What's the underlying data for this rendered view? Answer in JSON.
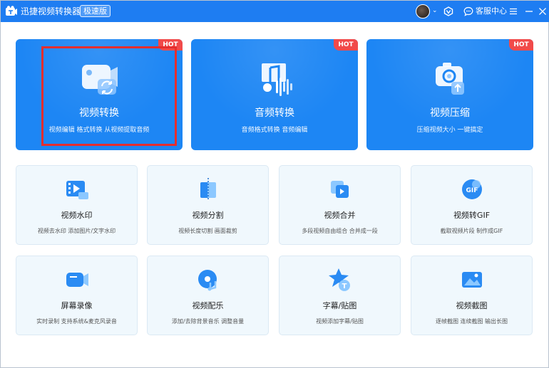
{
  "titlebar": {
    "title": "迅捷视频转换器",
    "edition": "极速版",
    "avatar_caret": "⌄",
    "service_label": "客服中心"
  },
  "big_cards": [
    {
      "title": "视频转换",
      "subtitle": "视频编辑 格式转换 从视频提取音频",
      "badge": "HOT",
      "icon": "video-convert-icon"
    },
    {
      "title": "音频转换",
      "subtitle": "音频格式转换 音频编辑",
      "badge": "HOT",
      "icon": "audio-convert-icon"
    },
    {
      "title": "视频压缩",
      "subtitle": "压缩视频大小 一键搞定",
      "badge": "HOT",
      "icon": "video-compress-icon"
    }
  ],
  "small_cards": [
    {
      "title": "视频水印",
      "subtitle": "视频去水印 添加图片/文字水印",
      "icon": "watermark-icon"
    },
    {
      "title": "视频分割",
      "subtitle": "视频长度切割 画面裁剪",
      "icon": "split-icon"
    },
    {
      "title": "视频合并",
      "subtitle": "多段视频自由组合 合并成一段",
      "icon": "merge-icon"
    },
    {
      "title": "视频转GIF",
      "subtitle": "截取视频片段 制作成GIF",
      "icon": "gif-icon",
      "icon_text": "GIF"
    },
    {
      "title": "屏幕录像",
      "subtitle": "实时录制 支持系统&麦克风录音",
      "icon": "screen-record-icon"
    },
    {
      "title": "视频配乐",
      "subtitle": "添加/去除背景音乐 调整音量",
      "icon": "music-icon"
    },
    {
      "title": "字幕/贴图",
      "subtitle": "视频添加字幕/贴图",
      "icon": "subtitle-icon",
      "icon_text": "T"
    },
    {
      "title": "视频截图",
      "subtitle": "逐帧截图 连续截图 输出长图",
      "icon": "screenshot-icon"
    }
  ],
  "colors": {
    "titlebar": "#1e7df2",
    "big_card": "#1d86f4",
    "hot_badge": "#f14a4a",
    "small_card": "#f0f8fd",
    "highlight": "#e62e2e"
  }
}
